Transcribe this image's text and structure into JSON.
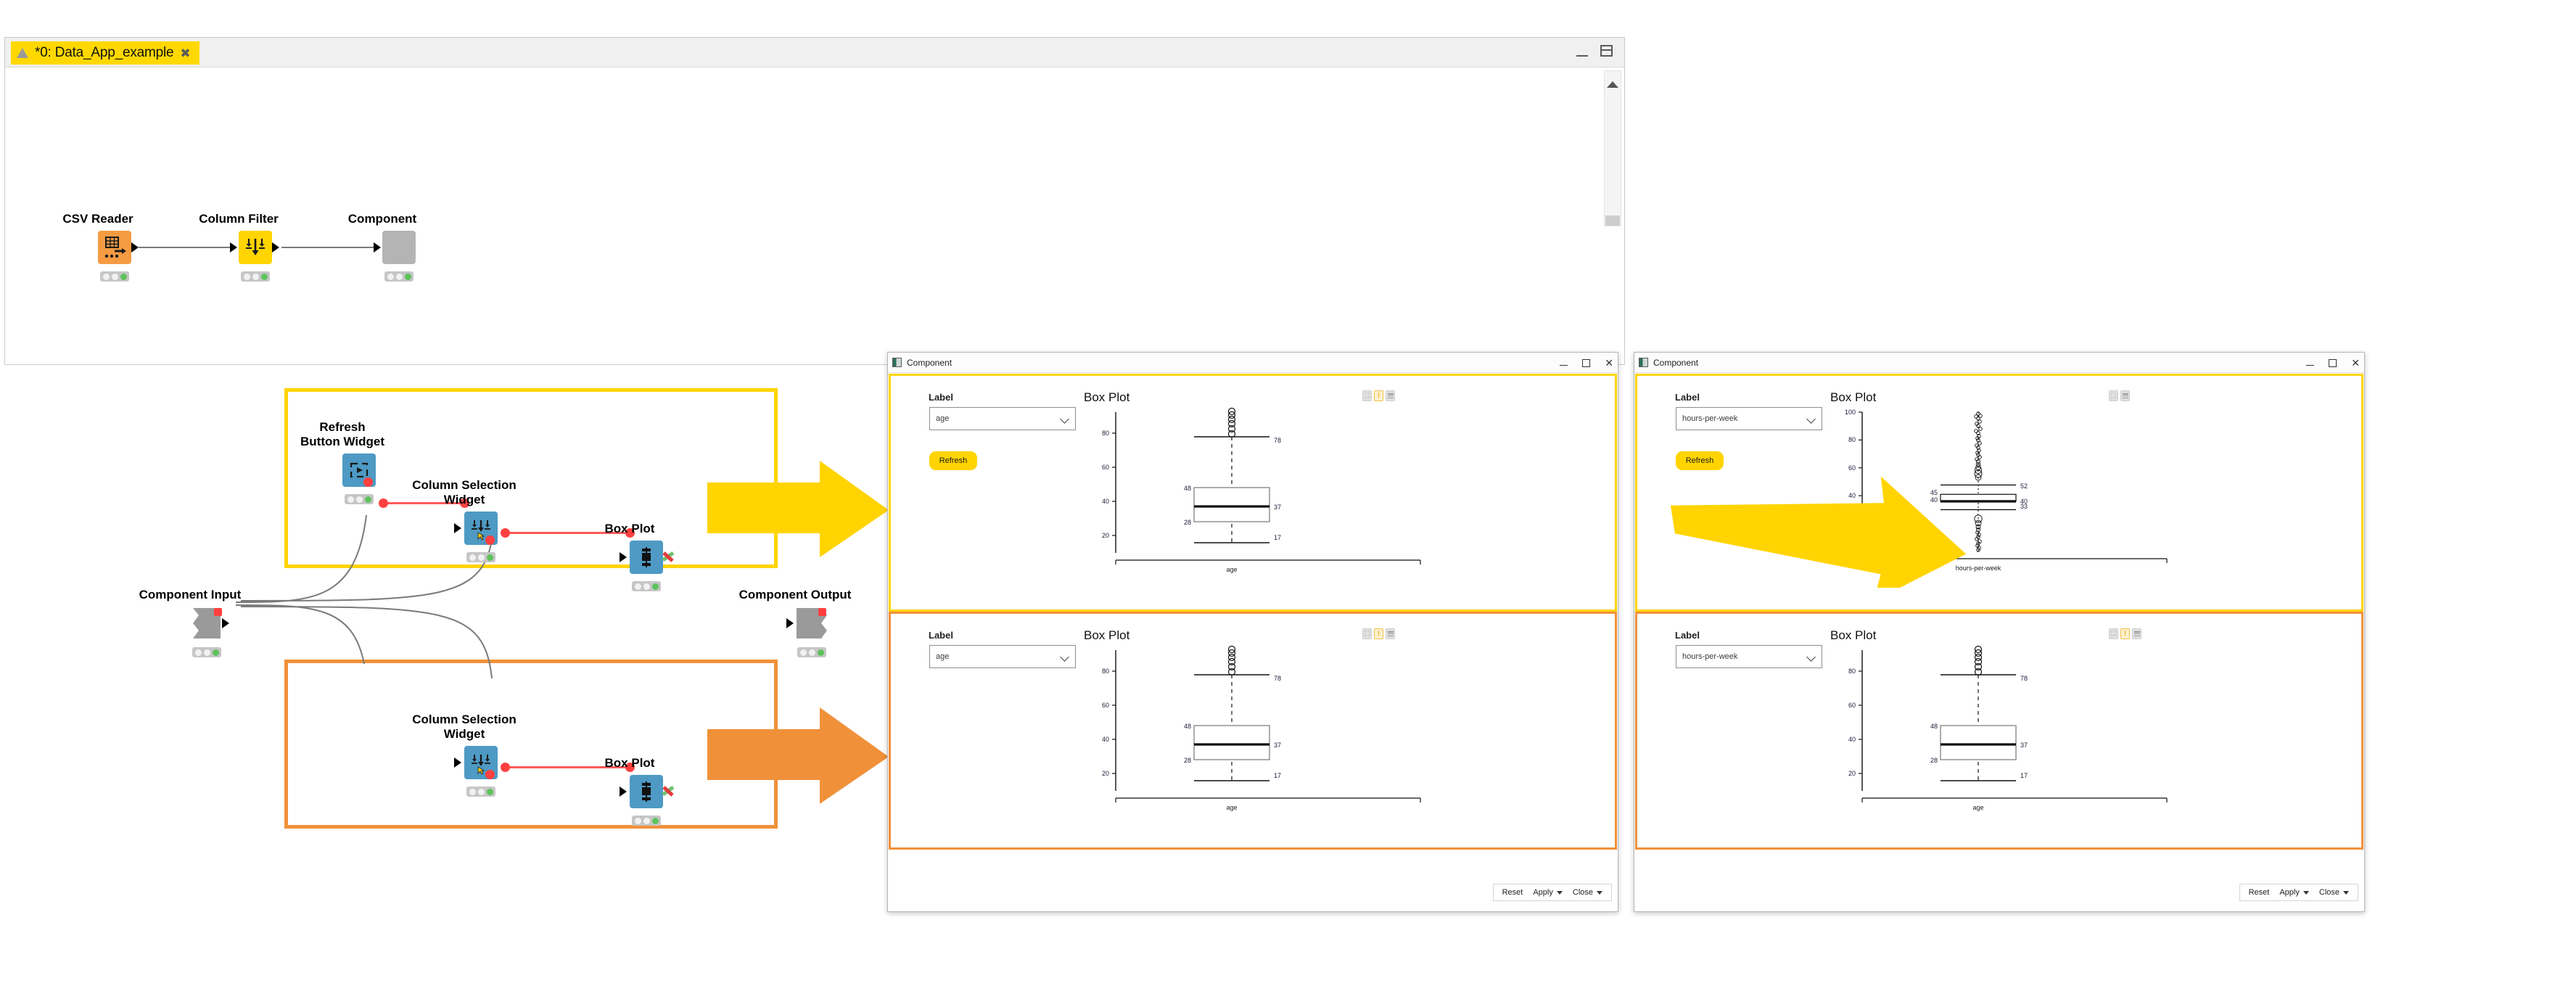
{
  "editor": {
    "tab_label": "*0: Data_App_example",
    "tab_close_icon": "close-icon",
    "warning_icon": "warning-triangle-icon",
    "minimize_icon": "minimize-icon",
    "maximize_icon": "maximize-icon",
    "scroll_up_icon": "scroll-up-arrow-icon"
  },
  "workflow": {
    "top_nodes": [
      {
        "name": "CSV Reader",
        "icon": "csv-reader-icon",
        "color": "#f59b42"
      },
      {
        "name": "Column Filter",
        "icon": "column-filter-icon",
        "color": "#ffd400"
      },
      {
        "name": "Component",
        "icon": "component-icon",
        "color": "#b4b4b4"
      }
    ],
    "component_input": {
      "name": "Component Input",
      "icon": "component-input-icon"
    },
    "component_output": {
      "name": "Component Output",
      "icon": "component-output-icon"
    },
    "yellow_group": {
      "nodes": [
        {
          "name": "Refresh\nButton Widget",
          "line1": "Refresh",
          "line2": "Button Widget",
          "icon": "refresh-button-widget-icon"
        },
        {
          "name": "Column Selection Widget",
          "line1": "Column Selection",
          "line2": "Widget",
          "icon": "column-selection-widget-icon"
        },
        {
          "name": "Box Plot",
          "line1": "Box Plot",
          "line2": "",
          "icon": "box-plot-node-icon"
        }
      ]
    },
    "orange_group": {
      "nodes": [
        {
          "name": "Column Selection Widget",
          "line1": "Column Selection",
          "line2": "Widget",
          "icon": "column-selection-widget-icon"
        },
        {
          "name": "Box Plot",
          "line1": "Box Plot",
          "line2": "",
          "icon": "box-plot-node-icon"
        }
      ]
    }
  },
  "colors": {
    "highlight_yellow": "#ffd400",
    "highlight_orange": "#f0913a",
    "node_blue": "#4e9ac4",
    "node_orange": "#f59b42",
    "node_yellow": "#ffd400",
    "node_grey": "#b4b4b4",
    "connection_red": "#ff5a5a",
    "status_green": "#5cc35c"
  },
  "dialog_left": {
    "title": "Component",
    "icon": "knime-component-icon",
    "window_buttons": [
      "minimize-icon",
      "maximize-icon",
      "close-icon"
    ],
    "footer": {
      "reset": "Reset",
      "apply": "Apply",
      "close": "Close",
      "apply_caret_icon": "caret-down-icon",
      "close_caret_icon": "caret-down-icon"
    },
    "panel_top": {
      "accent": "#ffd400",
      "label": "Label",
      "select_value": "age",
      "select_chevron_icon": "chevron-down-icon",
      "refresh_label": "Refresh",
      "plot_title": "Box Plot",
      "icons": [
        "fullscreen-icon",
        "warning-icon",
        "menu-icon"
      ]
    },
    "panel_bottom": {
      "accent": "#f0913a",
      "label": "Label",
      "select_value": "age",
      "select_chevron_icon": "chevron-down-icon",
      "plot_title": "Box Plot",
      "icons": [
        "fullscreen-icon",
        "warning-icon",
        "menu-icon"
      ]
    }
  },
  "dialog_right": {
    "title": "Component",
    "icon": "knime-component-icon",
    "window_buttons": [
      "minimize-icon",
      "maximize-icon",
      "close-icon"
    ],
    "footer": {
      "reset": "Reset",
      "apply": "Apply",
      "close": "Close",
      "apply_caret_icon": "caret-down-icon",
      "close_caret_icon": "caret-down-icon"
    },
    "panel_top": {
      "accent": "#ffd400",
      "label": "Label",
      "select_value": "hours-per-week",
      "select_chevron_icon": "chevron-down-icon",
      "refresh_label": "Refresh",
      "plot_title": "Box Plot",
      "icons": [
        "fullscreen-icon",
        "menu-icon"
      ]
    },
    "panel_bottom": {
      "accent": "#f0913a",
      "label": "Label",
      "select_value": "hours-per-week",
      "select_chevron_icon": "chevron-down-icon",
      "plot_title": "Box Plot",
      "icons": [
        "fullscreen-icon",
        "warning-icon",
        "menu-icon"
      ]
    }
  },
  "chart_data": [
    {
      "id": "left-top",
      "type": "box",
      "title": "Box Plot",
      "xlabel": "age",
      "ylabel": "",
      "categories": [
        "age"
      ],
      "yticks": [
        20,
        40,
        60,
        80
      ],
      "ylim": [
        13,
        92
      ],
      "boxes": [
        {
          "name": "age",
          "min": 17,
          "q1": 28,
          "median": 37,
          "q3": 48,
          "max": 78,
          "labels": {
            "max": "78",
            "q3": "48",
            "median": "37",
            "q1": "28",
            "min": "17"
          },
          "outliers": [
            79,
            81,
            83,
            85,
            86,
            88,
            90
          ]
        }
      ]
    },
    {
      "id": "left-bottom",
      "type": "box",
      "title": "Box Plot",
      "xlabel": "age",
      "ylabel": "",
      "categories": [
        "age"
      ],
      "yticks": [
        20,
        40,
        60,
        80
      ],
      "ylim": [
        13,
        92
      ],
      "boxes": [
        {
          "name": "age",
          "min": 17,
          "q1": 28,
          "median": 37,
          "q3": 48,
          "max": 78,
          "labels": {
            "max": "78",
            "q3": "48",
            "median": "37",
            "q1": "28",
            "min": "17"
          },
          "outliers": [
            79,
            81,
            83,
            85,
            86,
            88,
            90
          ]
        }
      ]
    },
    {
      "id": "right-top",
      "type": "box",
      "title": "Box Plot",
      "xlabel": "hours-per-week",
      "ylabel": "",
      "categories": [
        "hours-per-week"
      ],
      "yticks": [
        0,
        20,
        40,
        60,
        80,
        100
      ],
      "ylim": [
        0,
        100
      ],
      "boxes": [
        {
          "name": "hours-per-week",
          "min": 33,
          "q1": 40,
          "median": 40,
          "q3": 45,
          "max": 52,
          "labels": {
            "max": "52",
            "q3": "45",
            "median": "40",
            "q1": "40",
            "min": "33"
          },
          "outliers": [
            1,
            2,
            3,
            5,
            6,
            8,
            10,
            12,
            14,
            15,
            16,
            18,
            20,
            22,
            24,
            25,
            26,
            28,
            30,
            31,
            32,
            53,
            54,
            55,
            56,
            58,
            60,
            62,
            64,
            65,
            66,
            68,
            70,
            72,
            75,
            78,
            80,
            84,
            88,
            90,
            95,
            98,
            99
          ]
        }
      ]
    },
    {
      "id": "right-bottom",
      "type": "box",
      "title": "Box Plot",
      "xlabel": "age",
      "ylabel": "",
      "categories": [
        "age"
      ],
      "yticks": [
        20,
        40,
        60,
        80
      ],
      "ylim": [
        13,
        92
      ],
      "boxes": [
        {
          "name": "age",
          "min": 17,
          "q1": 28,
          "median": 37,
          "q3": 48,
          "max": 78,
          "labels": {
            "max": "78",
            "q3": "48",
            "median": "37",
            "q1": "28",
            "min": "17"
          },
          "outliers": [
            79,
            81,
            83,
            85,
            86,
            88,
            90
          ]
        }
      ]
    }
  ]
}
